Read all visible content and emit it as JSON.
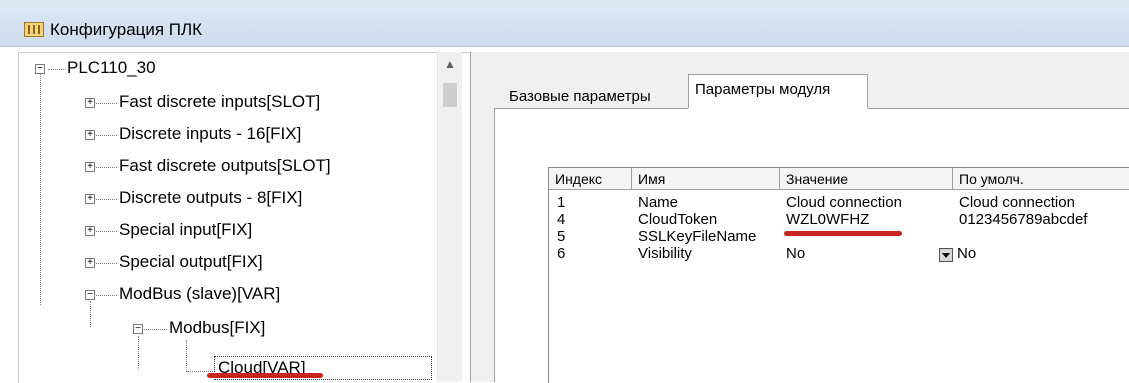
{
  "window": {
    "title": "Конфигурация ПЛК",
    "icon": "plc-config-icon"
  },
  "tree": {
    "root": "PLC110_30",
    "items": [
      "Fast discrete inputs[SLOT]",
      "Discrete inputs - 16[FIX]",
      "Fast discrete outputs[SLOT]",
      "Discrete outputs - 8[FIX]",
      "Special input[FIX]",
      "Special output[FIX]",
      "ModBus (slave)[VAR]"
    ],
    "modbus_child": "Modbus[FIX]",
    "selected_leaf": "Cloud[VAR]",
    "expander_collapsed": "+",
    "expander_expanded": "−"
  },
  "scrollbar": {
    "up_arrow": "▲"
  },
  "tabs": [
    {
      "label": "Базовые параметры",
      "active": false
    },
    {
      "label": "Параметры модуля",
      "active": true
    }
  ],
  "table": {
    "headers": [
      "Индекс",
      "Имя",
      "Значение",
      "По умолч."
    ],
    "rows": [
      {
        "index": "1",
        "name": "Name",
        "value": "Cloud connection",
        "default": "Cloud connection"
      },
      {
        "index": "4",
        "name": "CloudToken",
        "value": "WZL0WFHZ",
        "default": "0123456789abcdef"
      },
      {
        "index": "5",
        "name": "SSLKeyFileName",
        "value": "",
        "default": ""
      },
      {
        "index": "6",
        "name": "Visibility",
        "value": "No",
        "default": "No"
      }
    ]
  },
  "colors": {
    "titlebar": "#dfe9f5",
    "highlight_underline": "#c8261e",
    "panel_bg": "#f0f0f0"
  }
}
